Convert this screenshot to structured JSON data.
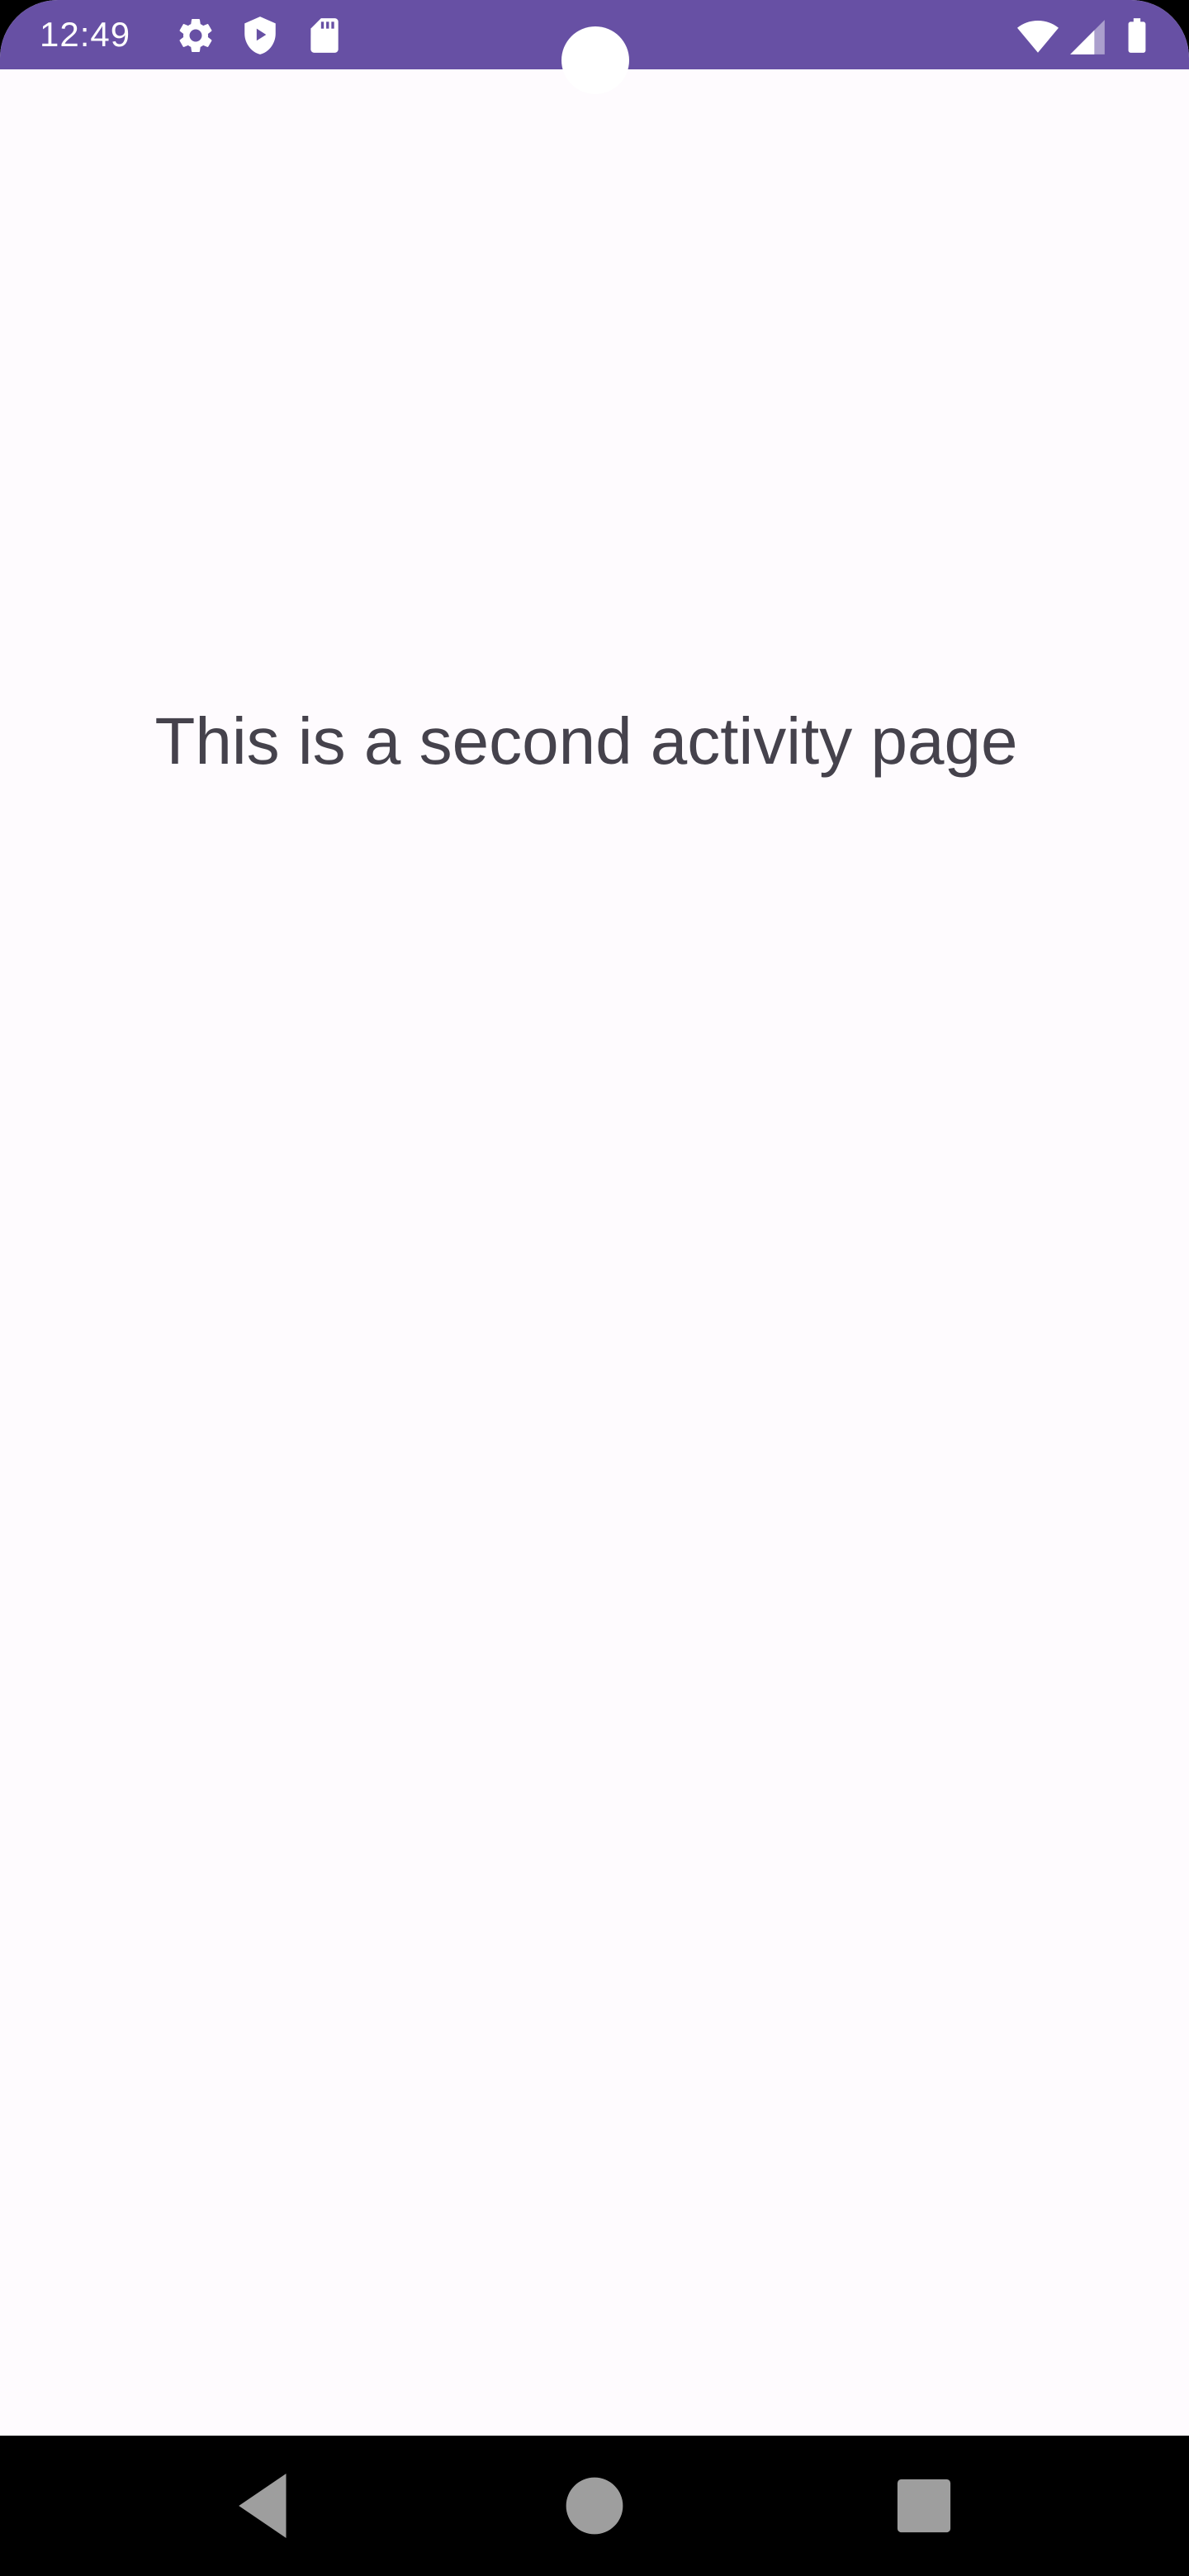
{
  "status_bar": {
    "time": "12:49",
    "background_color": "#6750A4",
    "left_icons": [
      "settings-icon",
      "play-protect-icon",
      "sd-card-icon"
    ],
    "right_icons": [
      "wifi-icon",
      "cellular-signal-icon",
      "battery-icon"
    ]
  },
  "main": {
    "message": "This is a second activity page",
    "background_color": "#FEFBFE",
    "text_color": "#45424C"
  },
  "nav_bar": {
    "buttons": [
      "back-icon",
      "home-icon",
      "recents-icon"
    ]
  }
}
